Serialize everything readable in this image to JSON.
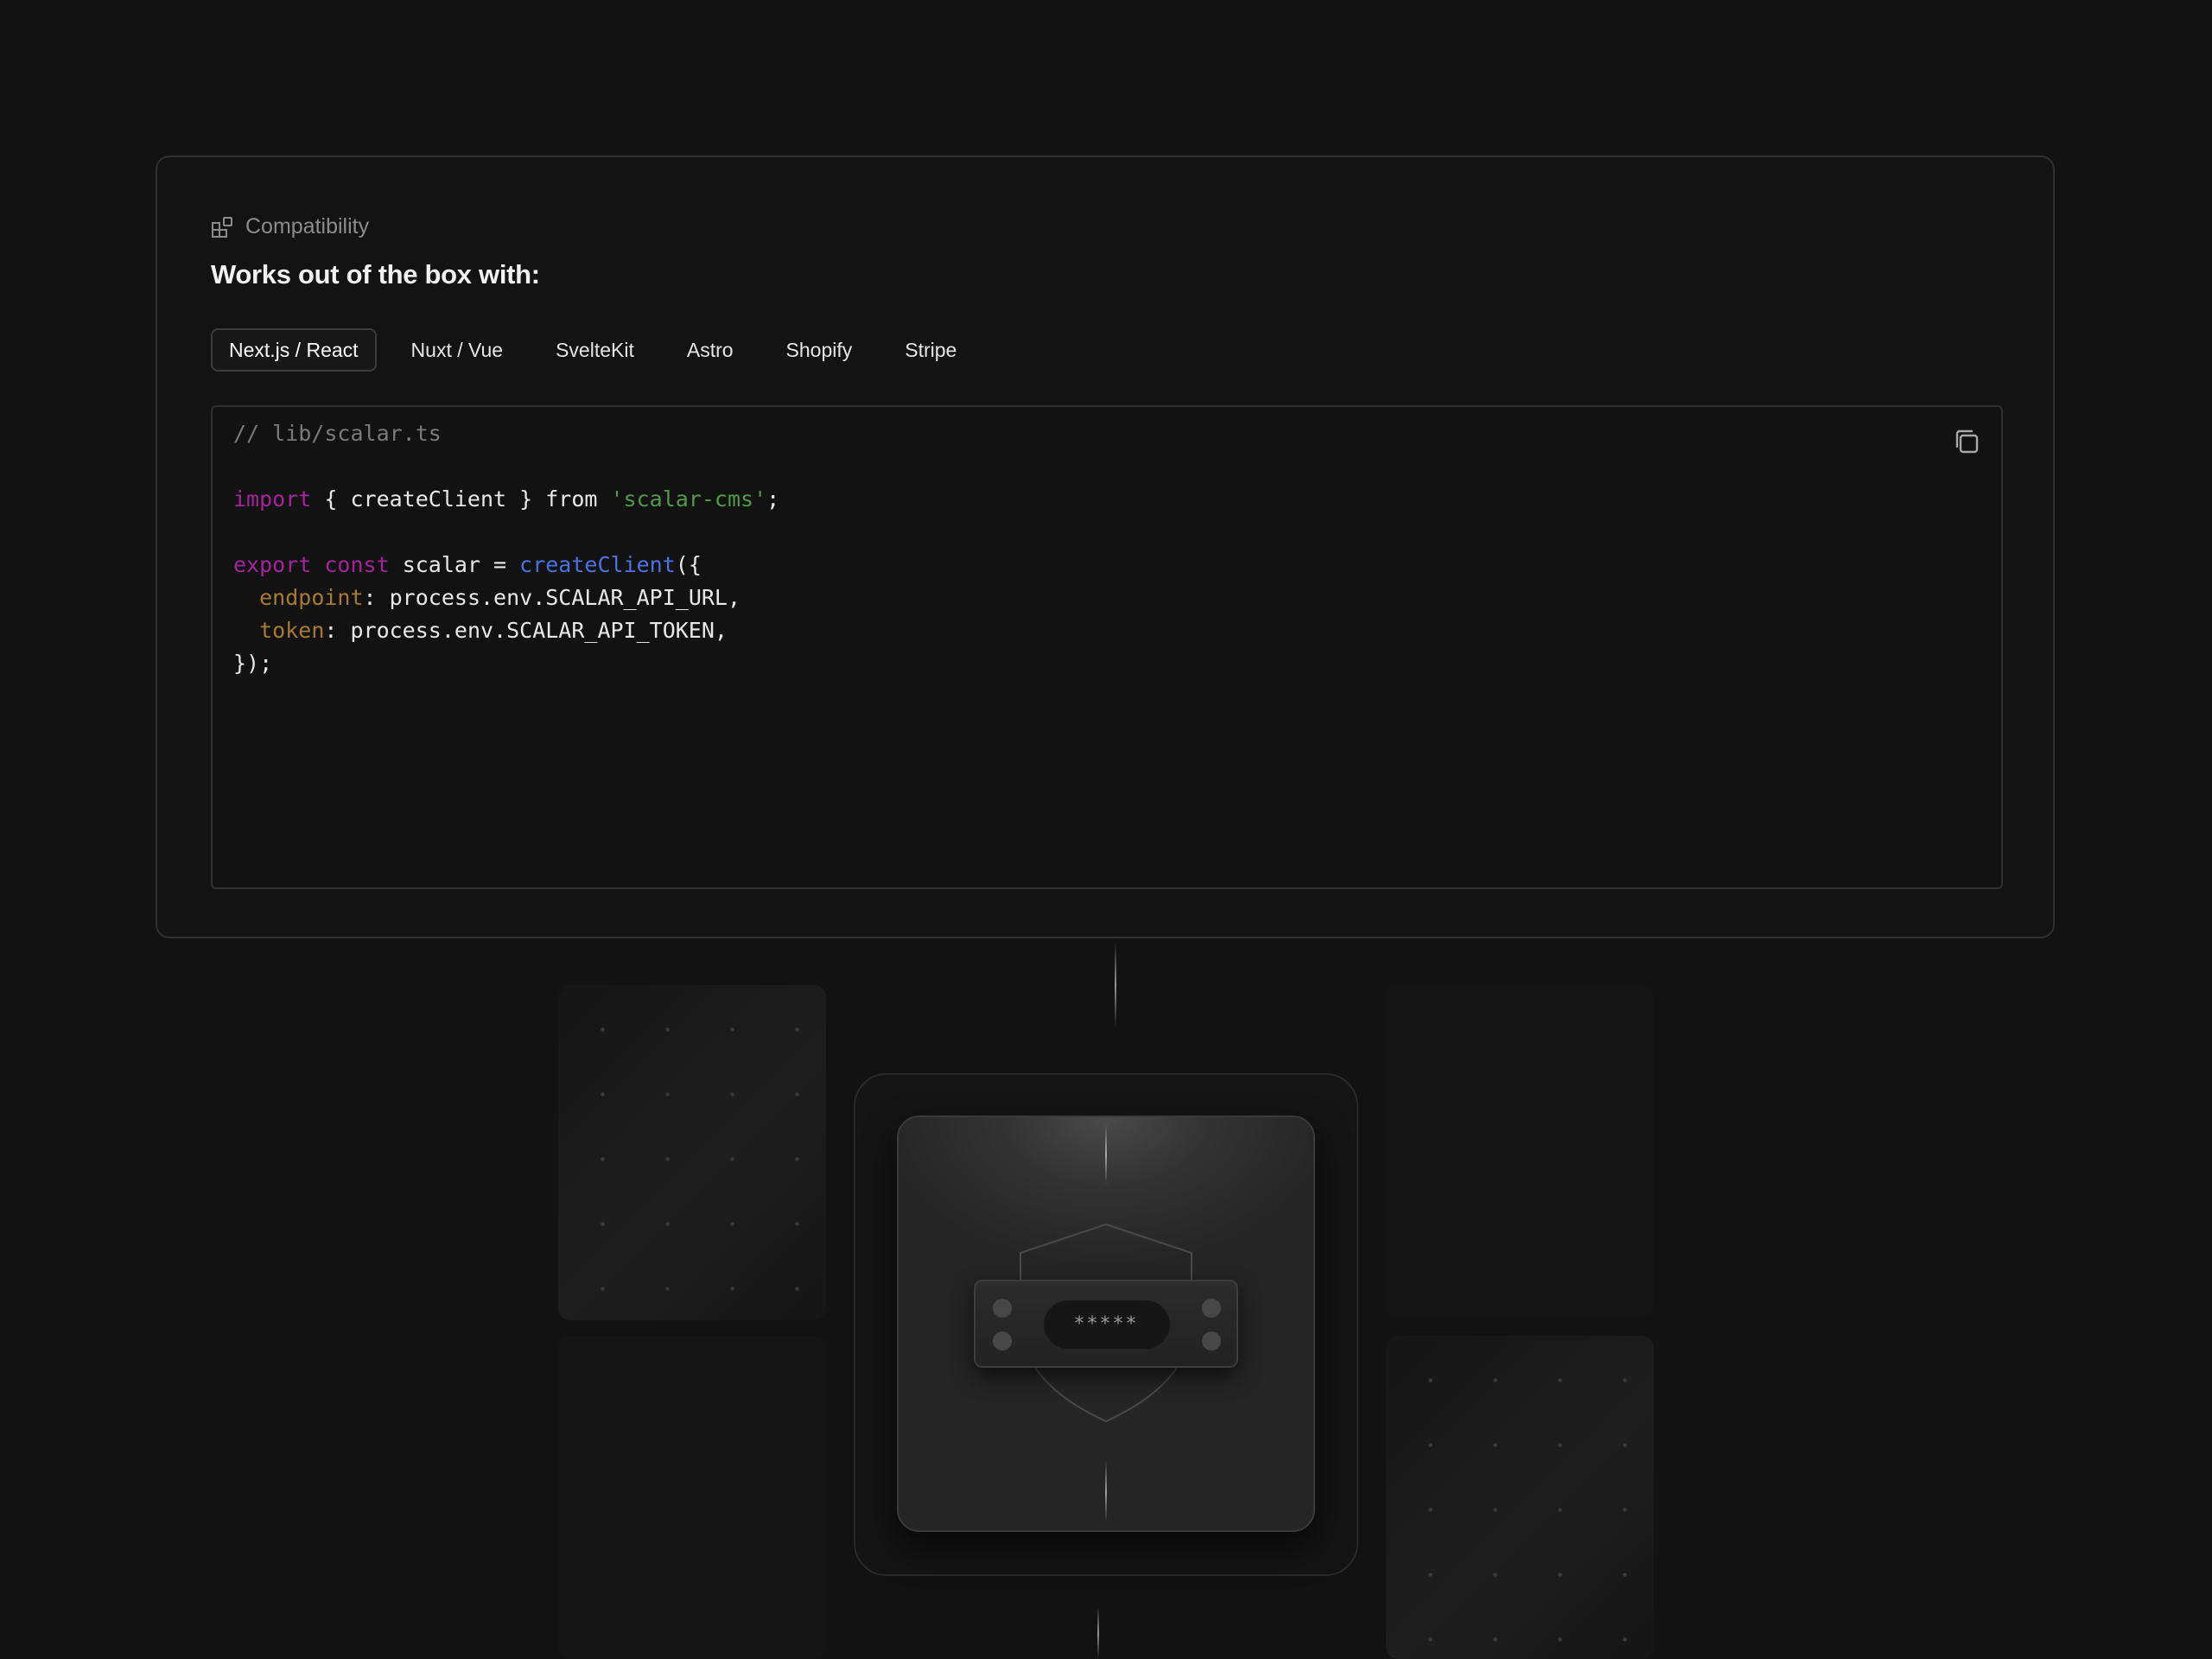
{
  "compatibility": {
    "eyebrow": "Compatibility",
    "eyebrow_icon": "blocks-icon",
    "title": "Works out of the box with:",
    "tabs": [
      {
        "label": "Next.js / React",
        "active": true
      },
      {
        "label": "Nuxt / Vue",
        "active": false
      },
      {
        "label": "SvelteKit",
        "active": false
      },
      {
        "label": "Astro",
        "active": false
      },
      {
        "label": "Shopify",
        "active": false
      },
      {
        "label": "Stripe",
        "active": false
      }
    ],
    "code": {
      "comment": "// lib/scalar.ts",
      "lines": {
        "import_kw": "import",
        "import_body": " { createClient } from ",
        "import_str": "'scalar-cms'",
        "import_end": ";",
        "export_kw": "export",
        "const_kw": "const",
        "scalar_assign": " scalar = ",
        "create_fn": "createClient",
        "create_open": "({",
        "endpoint_key": "endpoint",
        "endpoint_val": ": process.env.SCALAR_API_URL,",
        "token_key": "token",
        "token_val": ": process.env.SCALAR_API_TOKEN,",
        "close": "});"
      },
      "copy_icon": "copy-icon"
    }
  },
  "illustration": {
    "masked_token": "*****"
  },
  "colors": {
    "background": "#121212",
    "keyword": "#a3249c",
    "string": "#4f9b46",
    "function": "#4b73e0",
    "property": "#a67a33",
    "comment": "#7a7a7a"
  }
}
